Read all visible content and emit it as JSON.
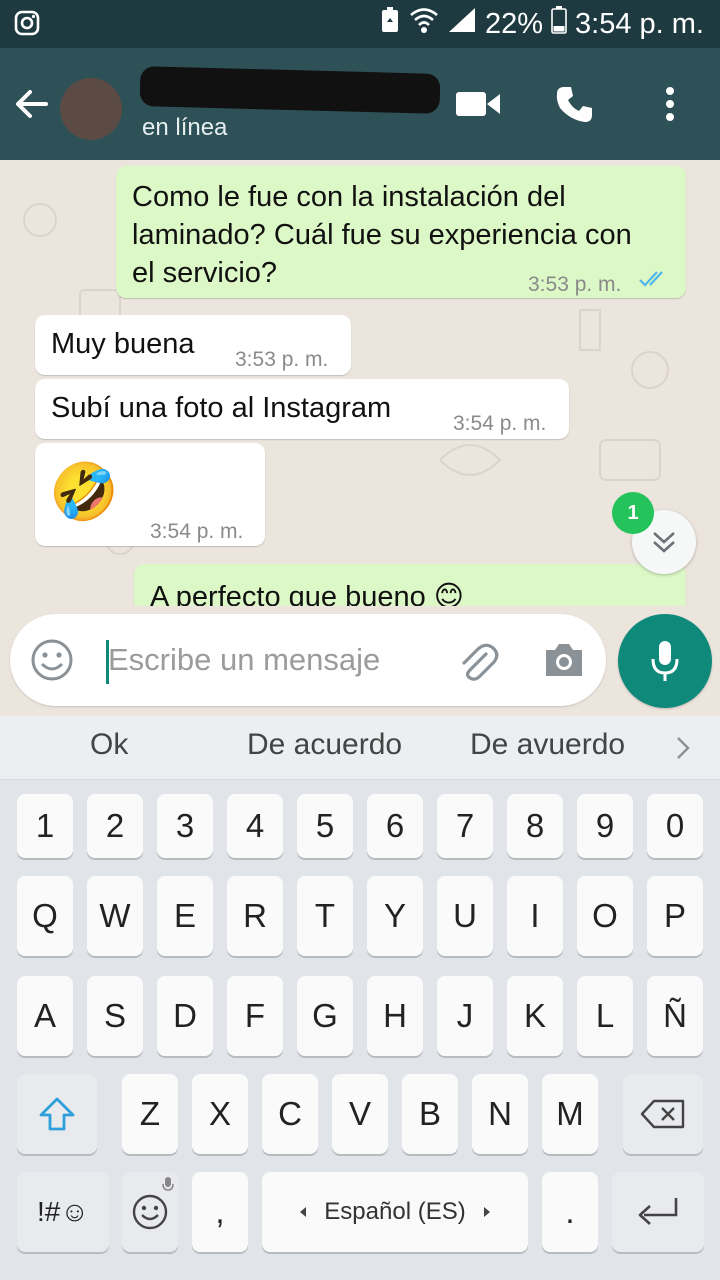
{
  "status_bar": {
    "battery": "22%",
    "time": "3:54 p. m."
  },
  "header": {
    "contact_status": "en línea"
  },
  "messages": [
    {
      "direction": "out",
      "text": "Como le fue con la instalación del laminado? Cuál fue su experiencia con el servicio?",
      "time": "3:53 p. m."
    },
    {
      "direction": "in",
      "text": "Muy buena",
      "time": "3:53 p. m."
    },
    {
      "direction": "in",
      "text": "Subí una foto al Instagram",
      "time": "3:54 p. m."
    },
    {
      "direction": "in",
      "text": "🤣",
      "time": "3:54 p. m."
    },
    {
      "direction": "out",
      "text": "A perfecto que bueno 😊",
      "time": ""
    }
  ],
  "unread_count": "1",
  "composer": {
    "placeholder": "Escribe un mensaje"
  },
  "suggestions": [
    "Ok",
    "De acuerdo",
    "De avuerdo"
  ],
  "keyboard": {
    "row_numbers": [
      "1",
      "2",
      "3",
      "4",
      "5",
      "6",
      "7",
      "8",
      "9",
      "0"
    ],
    "row_1": [
      "Q",
      "W",
      "E",
      "R",
      "T",
      "Y",
      "U",
      "I",
      "O",
      "P"
    ],
    "row_2": [
      "A",
      "S",
      "D",
      "F",
      "G",
      "H",
      "J",
      "K",
      "L",
      "Ñ"
    ],
    "row_3": [
      "Z",
      "X",
      "C",
      "V",
      "B",
      "N",
      "M"
    ],
    "symbols_label": "!#☺",
    "comma": ",",
    "space_label": "Español (ES)",
    "period": "."
  },
  "colors": {
    "header_bg": "#2e5157",
    "statusbar_bg": "#1e3a40",
    "outgoing_bubble": "#dcf8c6",
    "incoming_bubble": "#ffffff",
    "accent": "#0f8a7a",
    "read_ticks": "#4fb6ec",
    "badge": "#25c35b"
  }
}
